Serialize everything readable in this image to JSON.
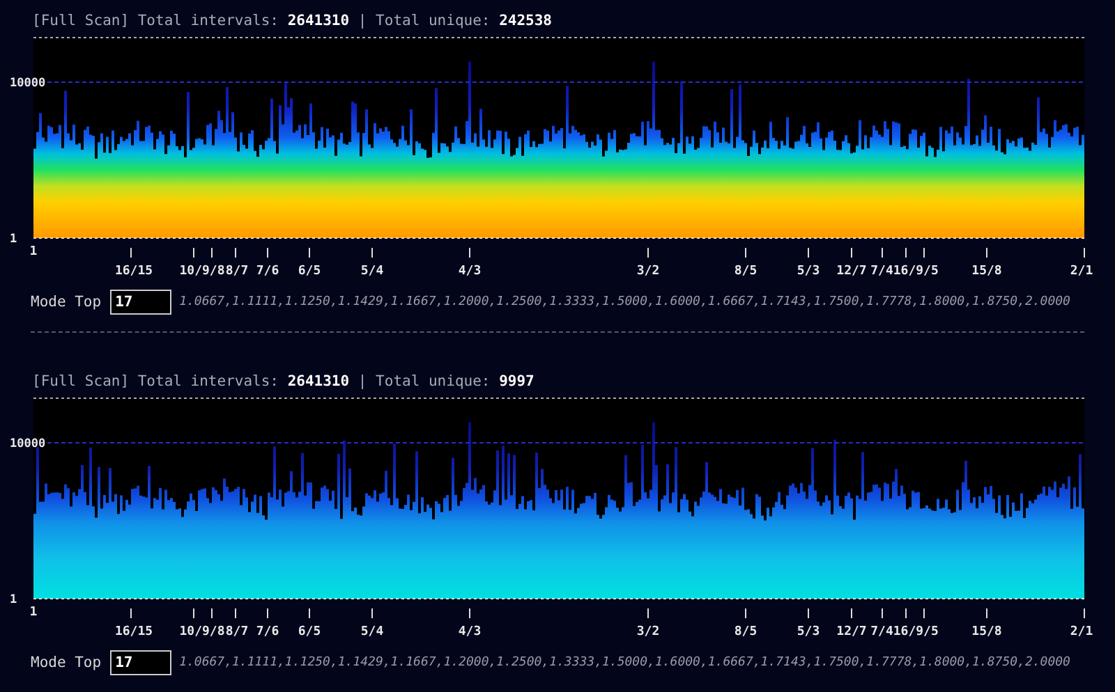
{
  "panels": [
    {
      "header": "[Full Scan] Total intervals: **2641310** | Total unique: **242538**",
      "kind": "jet",
      "y_axis_labels": [
        "10000",
        "1"
      ],
      "x_axis_labels": [
        "1",
        "16/15",
        "10/9/8",
        "8/7",
        "7/6",
        "6/5",
        "5/4",
        "4/3",
        "3/2",
        "8/5",
        "5/3",
        "12/7",
        "7/416/9/5",
        "15/8",
        "2/1"
      ],
      "mode_label": "Mode Top",
      "mode_value": "17",
      "modes": "1.0667,1.1111,1.1250,1.1429,1.1667,1.2000,1.2500,1.3333,1.5000,1.6000,1.6667,1.7143,1.7500,1.7778,1.8000,1.8750,2.0000"
    },
    {
      "header": "[Full Scan] Total intervals: **2641310** | Total unique: **9997**",
      "kind": "cyan",
      "y_axis_labels": [
        "10000",
        "1"
      ],
      "x_axis_labels": [
        "1",
        "16/15",
        "10/9/8",
        "8/7",
        "7/6",
        "6/5",
        "5/4",
        "4/3",
        "3/2",
        "8/5",
        "5/3",
        "12/7",
        "7/416/9/5",
        "15/8",
        "2/1"
      ],
      "mode_label": "Mode Top",
      "mode_value": "17",
      "modes": "1.0667,1.1111,1.1250,1.1429,1.1667,1.2000,1.2500,1.3333,1.5000,1.6000,1.6667,1.7143,1.7500,1.7778,1.8000,1.8750,2.0000"
    }
  ]
}
